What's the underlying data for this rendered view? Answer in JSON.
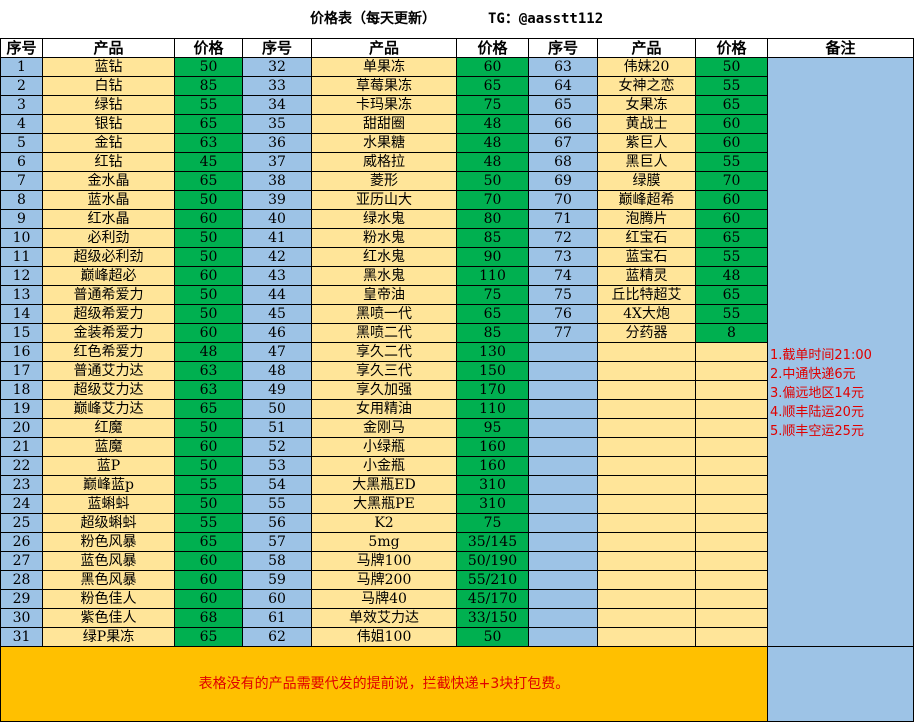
{
  "title": {
    "main": "价格表（每天更新）",
    "contact": "TG：@aasstt112"
  },
  "headers": {
    "seq": "序号",
    "product": "产品",
    "price": "价格",
    "remark": "备注"
  },
  "col1": [
    [
      "1",
      "蓝钻",
      "50"
    ],
    [
      "2",
      "白钻",
      "85"
    ],
    [
      "3",
      "绿钻",
      "55"
    ],
    [
      "4",
      "银钻",
      "65"
    ],
    [
      "5",
      "金钻",
      "63"
    ],
    [
      "6",
      "红钻",
      "45"
    ],
    [
      "7",
      "金水晶",
      "65"
    ],
    [
      "8",
      "蓝水晶",
      "50"
    ],
    [
      "9",
      "红水晶",
      "60"
    ],
    [
      "10",
      "必利劲",
      "50"
    ],
    [
      "11",
      "超级必利劲",
      "50"
    ],
    [
      "12",
      "巅峰超必",
      "60"
    ],
    [
      "13",
      "普通希爱力",
      "50"
    ],
    [
      "14",
      "超级希爱力",
      "50"
    ],
    [
      "15",
      "金装希爱力",
      "60"
    ],
    [
      "16",
      "红色希爱力",
      "48"
    ],
    [
      "17",
      "普通艾力达",
      "63"
    ],
    [
      "18",
      "超级艾力达",
      "63"
    ],
    [
      "19",
      "巅峰艾力达",
      "65"
    ],
    [
      "20",
      "红魔",
      "50"
    ],
    [
      "21",
      "蓝魔",
      "60"
    ],
    [
      "22",
      "蓝P",
      "50"
    ],
    [
      "23",
      "巅峰蓝p",
      "55"
    ],
    [
      "24",
      "蓝蝌蚪",
      "50"
    ],
    [
      "25",
      "超级蝌蚪",
      "55"
    ],
    [
      "26",
      "粉色风暴",
      "65"
    ],
    [
      "27",
      "蓝色风暴",
      "60"
    ],
    [
      "28",
      "黑色风暴",
      "60"
    ],
    [
      "29",
      "粉色佳人",
      "60"
    ],
    [
      "30",
      "紫色佳人",
      "68"
    ],
    [
      "31",
      "绿P果冻",
      "65"
    ]
  ],
  "col2": [
    [
      "32",
      "单果冻",
      "60"
    ],
    [
      "33",
      "草莓果冻",
      "65"
    ],
    [
      "34",
      "卡玛果冻",
      "75"
    ],
    [
      "35",
      "甜甜圈",
      "48"
    ],
    [
      "36",
      "水果糖",
      "48"
    ],
    [
      "37",
      "威格拉",
      "48"
    ],
    [
      "38",
      "菱形",
      "50"
    ],
    [
      "39",
      "亚历山大",
      "70"
    ],
    [
      "40",
      "绿水鬼",
      "80"
    ],
    [
      "41",
      "粉水鬼",
      "85"
    ],
    [
      "42",
      "红水鬼",
      "90"
    ],
    [
      "43",
      "黑水鬼",
      "110"
    ],
    [
      "44",
      "皇帝油",
      "75"
    ],
    [
      "45",
      "黑喷一代",
      "65"
    ],
    [
      "46",
      "黑喷二代",
      "85"
    ],
    [
      "47",
      "享久二代",
      "130"
    ],
    [
      "48",
      "享久三代",
      "150"
    ],
    [
      "49",
      "享久加强",
      "170"
    ],
    [
      "50",
      "女用精油",
      "110"
    ],
    [
      "51",
      "金刚马",
      "95"
    ],
    [
      "52",
      "小绿瓶",
      "160"
    ],
    [
      "53",
      "小金瓶",
      "160"
    ],
    [
      "54",
      "大黑瓶ED",
      "310"
    ],
    [
      "55",
      "大黑瓶PE",
      "310"
    ],
    [
      "56",
      "K2",
      "75"
    ],
    [
      "57",
      "5mg",
      "35/145"
    ],
    [
      "58",
      "马牌100",
      "50/190"
    ],
    [
      "59",
      "马牌200",
      "55/210"
    ],
    [
      "60",
      "马牌40",
      "45/170"
    ],
    [
      "61",
      "单效艾力达",
      "33/150"
    ],
    [
      "62",
      "伟姐100",
      "50"
    ]
  ],
  "col3": [
    [
      "63",
      "伟妹20",
      "50"
    ],
    [
      "64",
      "女神之恋",
      "55"
    ],
    [
      "65",
      "女果冻",
      "65"
    ],
    [
      "66",
      "黄战士",
      "60"
    ],
    [
      "67",
      "紫巨人",
      "60"
    ],
    [
      "68",
      "黑巨人",
      "55"
    ],
    [
      "69",
      "绿膜",
      "70"
    ],
    [
      "70",
      "巅峰超希",
      "60"
    ],
    [
      "71",
      "泡腾片",
      "60"
    ],
    [
      "72",
      "红宝石",
      "65"
    ],
    [
      "73",
      "蓝宝石",
      "55"
    ],
    [
      "74",
      "蓝精灵",
      "48"
    ],
    [
      "75",
      "丘比特超艾",
      "65"
    ],
    [
      "76",
      "4X大炮",
      "55"
    ],
    [
      "77",
      "分药器",
      "8"
    ]
  ],
  "notes": [
    "1.截单时间21:00",
    "2.中通快递6元",
    "3.偏远地区14元",
    "4.顺丰陆运20元",
    "5.顺丰空运25元"
  ],
  "footer": "表格没有的产品需要代发的提前说，拦截快递+3块打包费。",
  "colors": {
    "seq": "#9dc3e6",
    "name": "#ffe599",
    "price": "#00b050",
    "footer": "#ffc000",
    "notes_text": "#e00000"
  }
}
